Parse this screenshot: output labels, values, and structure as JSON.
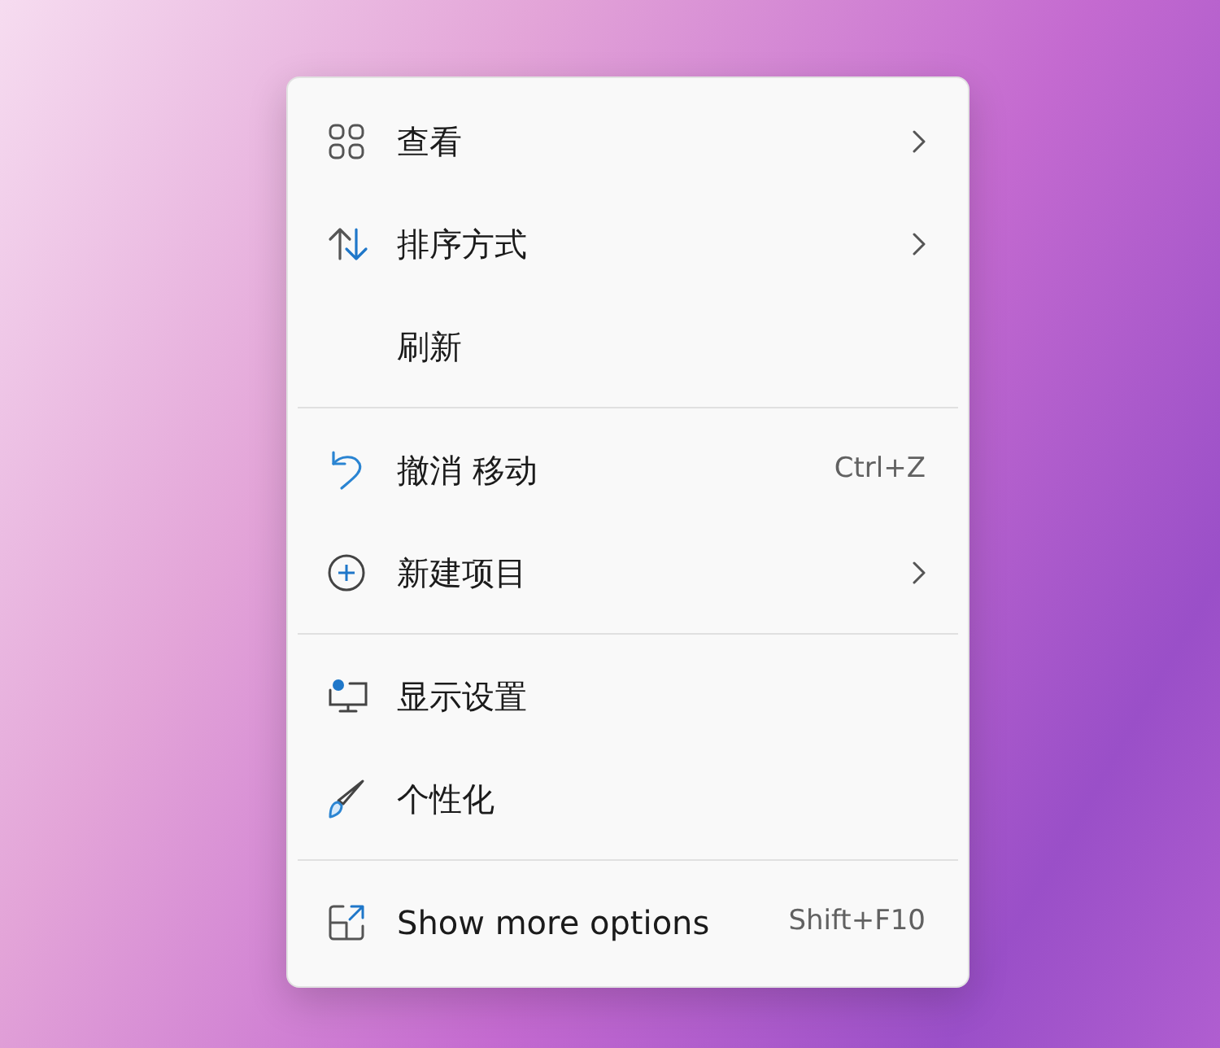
{
  "menu": {
    "groups": [
      {
        "items": [
          {
            "label": "查看",
            "submenu": true
          },
          {
            "label": "排序方式",
            "submenu": true
          },
          {
            "label": "刷新",
            "submenu": false
          }
        ]
      },
      {
        "items": [
          {
            "label": "撤消 移动",
            "shortcut": "Ctrl+Z",
            "submenu": false
          },
          {
            "label": "新建项目",
            "submenu": true
          }
        ]
      },
      {
        "items": [
          {
            "label": "显示设置",
            "submenu": false
          },
          {
            "label": "个性化",
            "submenu": false
          }
        ]
      },
      {
        "items": [
          {
            "label": "Show more options",
            "shortcut": "Shift+F10",
            "submenu": false
          }
        ]
      }
    ]
  }
}
